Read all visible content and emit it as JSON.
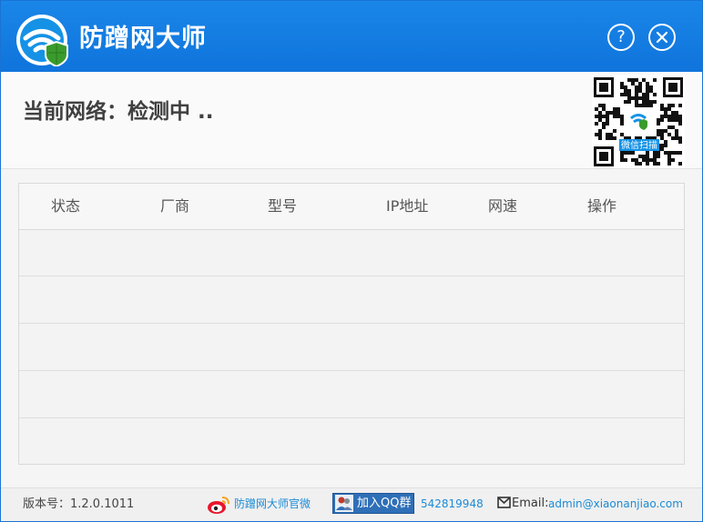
{
  "app": {
    "title": "防蹭网大师"
  },
  "titlebar": {
    "help_label": "?"
  },
  "network": {
    "label": "当前网络：检测中 .."
  },
  "qr": {
    "caption": "微信扫描"
  },
  "table": {
    "headers": [
      "状态",
      "厂商",
      "型号",
      "IP地址",
      "网速",
      "操作"
    ],
    "row_count": 5
  },
  "footer": {
    "version": "版本号：1.2.0.1011",
    "weibo_label": "防蹭网大师官微",
    "qq_button": "加入QQ群",
    "qq_number": "542819948",
    "email_label": "Email:",
    "email": "admin@xiaonanjiao.com"
  },
  "icons": {
    "logo": "wifi-shield-logo-icon",
    "help": "question-circle-icon",
    "close": "close-circle-icon",
    "qr": "qr-code",
    "weibo": "weibo-icon",
    "qq": "qq-people-icon",
    "mail": "envelope-icon"
  },
  "colors": {
    "titlebar": "#1a86e8",
    "link": "#1b8bd6",
    "qq_button": "#2f6fb7"
  }
}
